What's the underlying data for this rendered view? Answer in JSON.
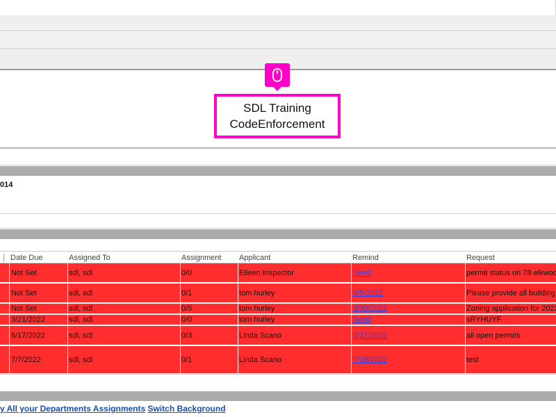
{
  "header": {
    "title_line1": "SDL Training",
    "title_line2": "CodeEnforcement"
  },
  "info": {
    "text": "014"
  },
  "columns": [
    "Date Due",
    "Assigned To",
    "Assignment",
    "Applicant",
    "Remind",
    "Request"
  ],
  "rows": [
    {
      "date_due": "Not Set",
      "assigned_to": "sdl, sdl",
      "assignment": "0/0",
      "applicant": "Eileen Inspector",
      "remind": "Send",
      "request": "permit status on 78 elkwoo"
    },
    {
      "date_due": "Not Set",
      "assigned_to": "sdl, sdl",
      "assignment": "0/1",
      "applicant": "tom hurley",
      "remind": "3/5/2022",
      "request": "Please provide all building a"
    },
    {
      "date_due": "Not Set",
      "assigned_to": "sdl, sdl",
      "assignment": "0/5",
      "applicant": "tom hurley",
      "remind": "3/30/2022",
      "request": "Zoning application for 2022"
    },
    {
      "date_due": "3/21/2022",
      "assigned_to": "sdl, sdl",
      "assignment": "0/0",
      "applicant": "tom hurley",
      "remind": "Send",
      "request": "sRYHUYF"
    },
    {
      "date_due": "6/17/2022",
      "assigned_to": "sdl, sdl",
      "assignment": "0/3",
      "applicant": "Linda Scano",
      "remind": "6/17/2022",
      "request": "all open permits"
    },
    {
      "date_due": "7/7/2022",
      "assigned_to": "sdl, sdl",
      "assignment": "0/1",
      "applicant": "Linda Scano",
      "remind": "7/18/2022",
      "request": "test"
    }
  ],
  "footer": {
    "link1": "y All your Departments Assignments",
    "link2": "Switch Background"
  },
  "colors": {
    "row_red": "#ff2d2d",
    "highlight": "#ff00c8",
    "link": "#1a4fa3"
  },
  "icons": {
    "click_marker": "mouse-icon"
  }
}
